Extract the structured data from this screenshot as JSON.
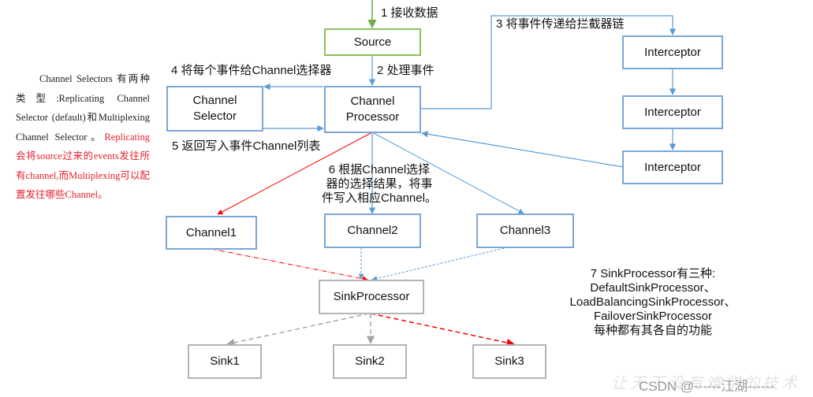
{
  "side_note": {
    "black_text": "Channel Selectors 有两种类型:Replicating Channel Selector (default)和Multiplexing Channel Selector。",
    "red_text": "Replicating 会将source过来的events发往所有channel,而Multiplexing可以配置发往哪些Channel。"
  },
  "nodes": {
    "source": "Source",
    "channel_selector": "Channel Selector",
    "channel_processor": "Channel Processor",
    "interceptor_1": "Interceptor",
    "interceptor_2": "Interceptor",
    "interceptor_3": "Interceptor",
    "channel1": "Channel1",
    "channel2": "Channel2",
    "channel3": "Channel3",
    "sink_processor": "SinkProcessor",
    "sink1": "Sink1",
    "sink2": "Sink2",
    "sink3": "Sink3"
  },
  "steps": {
    "step1": "1 接收数据",
    "step2": "2 处理事件",
    "step3": "3 将事件传递给拦截器链",
    "step4": "4 将每个事件给Channel选择器",
    "step5": "5 返回写入事件Channel列表",
    "step6": [
      "6 根据Channel选择",
      "器的选择结果，将事",
      "件写入相应Channel。"
    ],
    "step7": [
      "7 SinkProcessor有三种:",
      "DefaultSinkProcessor、",
      "LoadBalancingSinkProcessor、",
      "FailoverSinkProcessor",
      "每种都有其各自的功能"
    ]
  },
  "colors": {
    "blue": "#5b9bd5",
    "green": "#70ad47",
    "red": "#ff0000",
    "gray": "#a6a6a6"
  },
  "watermark": {
    "text": "CSDN @------江湖------",
    "background_text": "让天下没有难学的技术"
  }
}
